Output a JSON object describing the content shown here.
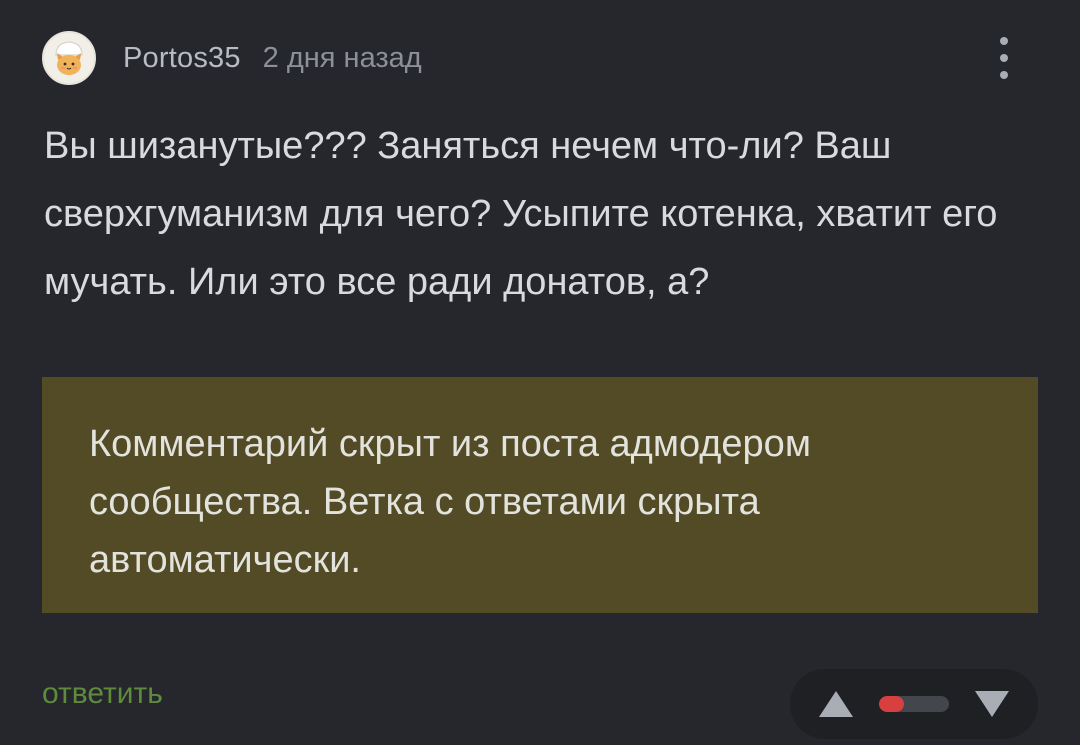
{
  "comment": {
    "author": "Portos35",
    "time": "2 дня назад",
    "avatar_icon": "chef-cat-avatar",
    "more_icon": "vertical-dots-icon",
    "text": "Вы шизанутые??? Заняться нечем что-ли? Ваш сверхгуманизм для чего? Усыпите котенка, хватит его мучать. Или это все ради донатов, а?"
  },
  "moderation_notice": {
    "text": "Комментарий скрыт из поста адмодером сообщества. Ветка с ответами скрыта автоматически.",
    "background_color": "#534b25"
  },
  "actions": {
    "reply_label": "ответить",
    "reply_color": "#5e8b3c",
    "upvote_icon": "triangle-up-icon",
    "downvote_icon": "triangle-down-icon",
    "rating_fill_fraction": 0.35,
    "rating_fill_color": "#d84040"
  }
}
